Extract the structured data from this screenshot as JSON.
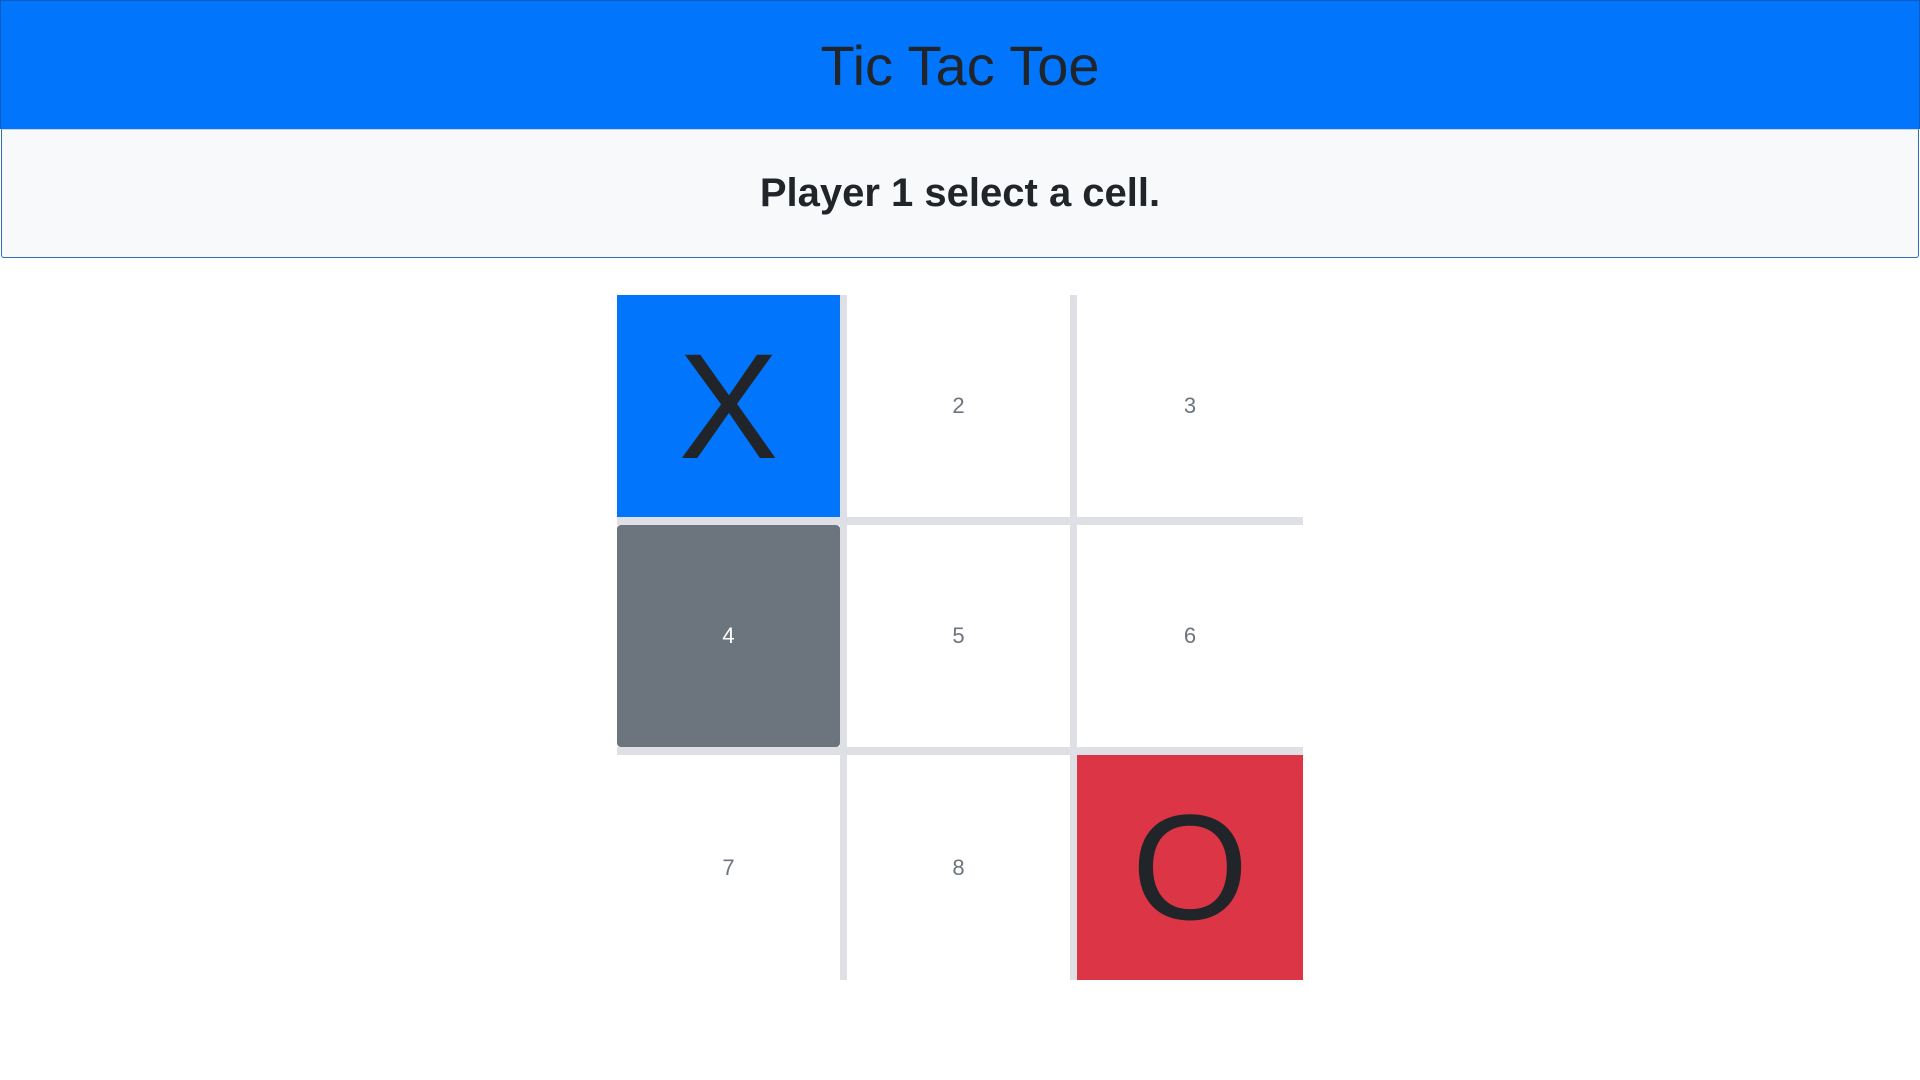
{
  "header": {
    "title": "Tic Tac Toe"
  },
  "status": {
    "message": "Player 1 select a cell."
  },
  "board": {
    "cells": [
      {
        "label": "X",
        "state": "x"
      },
      {
        "label": "2",
        "state": "empty"
      },
      {
        "label": "3",
        "state": "empty"
      },
      {
        "label": "4",
        "state": "hover"
      },
      {
        "label": "5",
        "state": "empty"
      },
      {
        "label": "6",
        "state": "empty"
      },
      {
        "label": "7",
        "state": "empty"
      },
      {
        "label": "8",
        "state": "empty"
      },
      {
        "label": "O",
        "state": "o"
      }
    ]
  },
  "colors": {
    "header_bg": "#0275fd",
    "x_cell_bg": "#0275fd",
    "o_cell_bg": "#dc3545",
    "hover_cell_bg": "#6c757d",
    "status_bg": "#f8f9fa",
    "grid_line": "#dee0e6"
  }
}
